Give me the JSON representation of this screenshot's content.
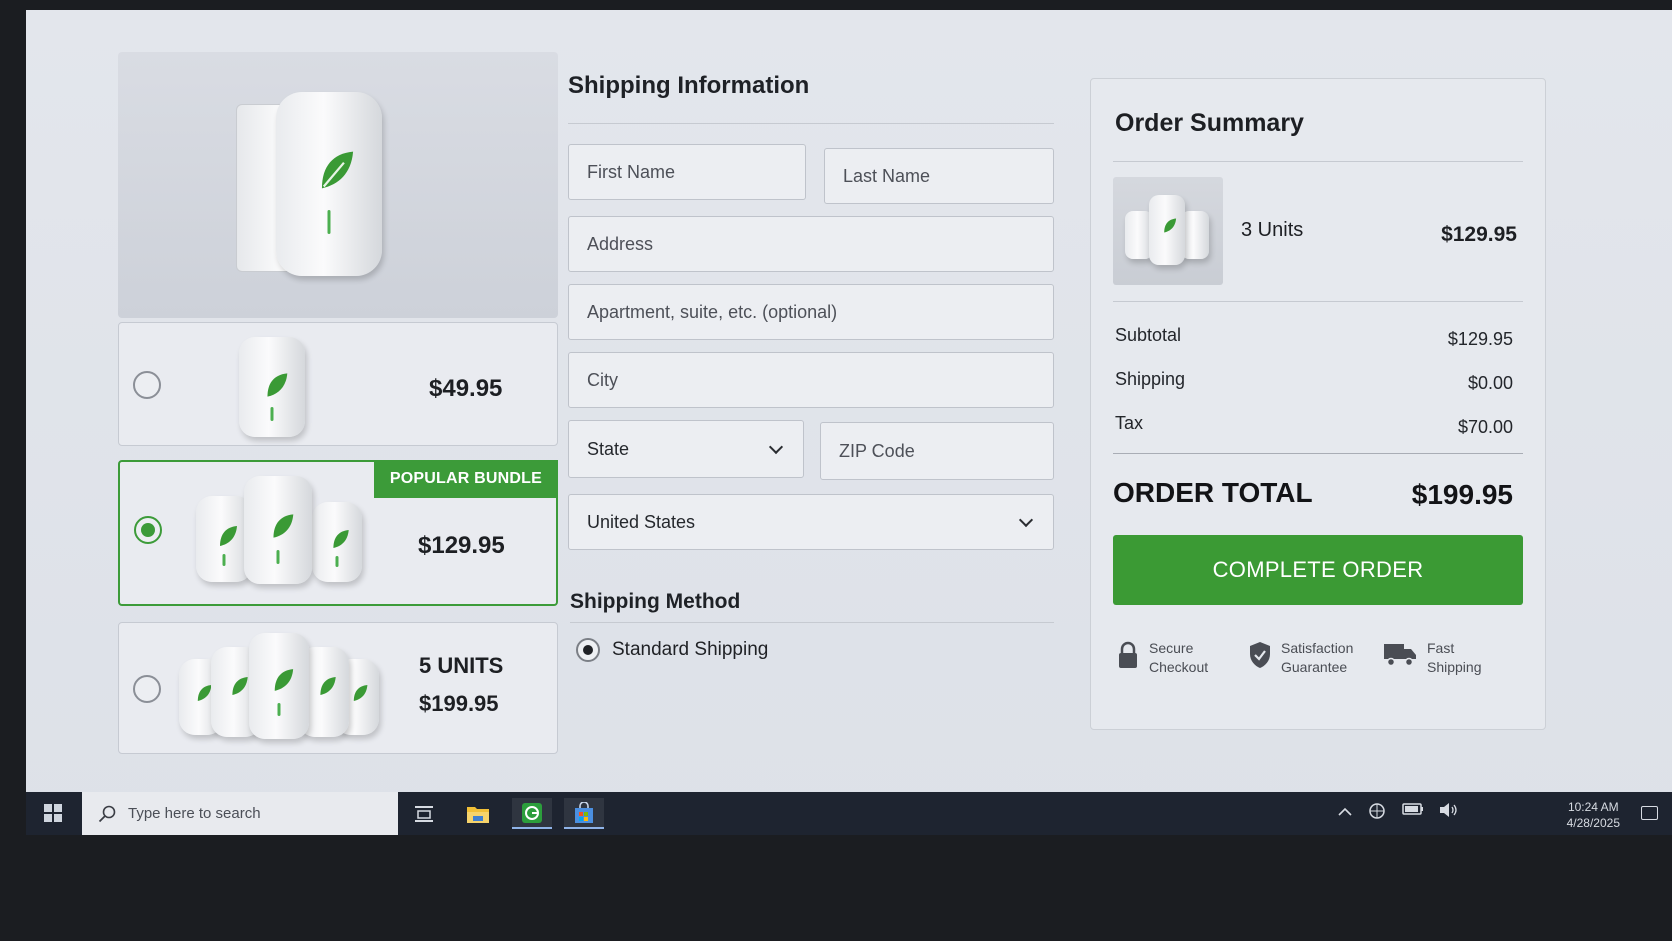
{
  "products": {
    "options": [
      {
        "price": "$49.95",
        "selected": false
      },
      {
        "badge": "POPULAR BUNDLE",
        "price": "$129.95",
        "selected": true
      },
      {
        "units": "5 UNITS",
        "price": "$199.95",
        "selected": false
      }
    ]
  },
  "shipping_form": {
    "title": "Shipping Information",
    "first_name_placeholder": "First Name",
    "last_name_placeholder": "Last Name",
    "address_placeholder": "Address",
    "apartment_placeholder": "Apartment, suite, etc. (optional)",
    "city_placeholder": "City",
    "state_label": "State",
    "zip_placeholder": "ZIP Code",
    "country_value": "United States",
    "method_title": "Shipping Method",
    "method_option": "Standard Shipping"
  },
  "summary": {
    "title": "Order Summary",
    "item_name": "3 Units",
    "item_price": "$129.95",
    "subtotal_label": "Subtotal",
    "subtotal_value": "$129.95",
    "shipping_label": "Shipping",
    "shipping_value": "$0.00",
    "tax_label": "Tax",
    "tax_value": "$70.00",
    "total_label": "ORDER TOTAL",
    "total_value": "$199.95",
    "cta_label": "COMPLETE ORDER",
    "trust": [
      {
        "line1": "Secure",
        "line2": "Checkout",
        "icon": "lock-icon"
      },
      {
        "line1": "Satisfaction",
        "line2": "Guarantee",
        "icon": "shield-check-icon"
      },
      {
        "line1": "Fast",
        "line2": "Shipping",
        "icon": "truck-icon"
      }
    ]
  },
  "taskbar": {
    "search_placeholder": "Type here to search",
    "time": "10:24 AM",
    "date": "4/28/2025"
  },
  "colors": {
    "accent": "#3b9a34",
    "taskbar": "#1e2430"
  }
}
